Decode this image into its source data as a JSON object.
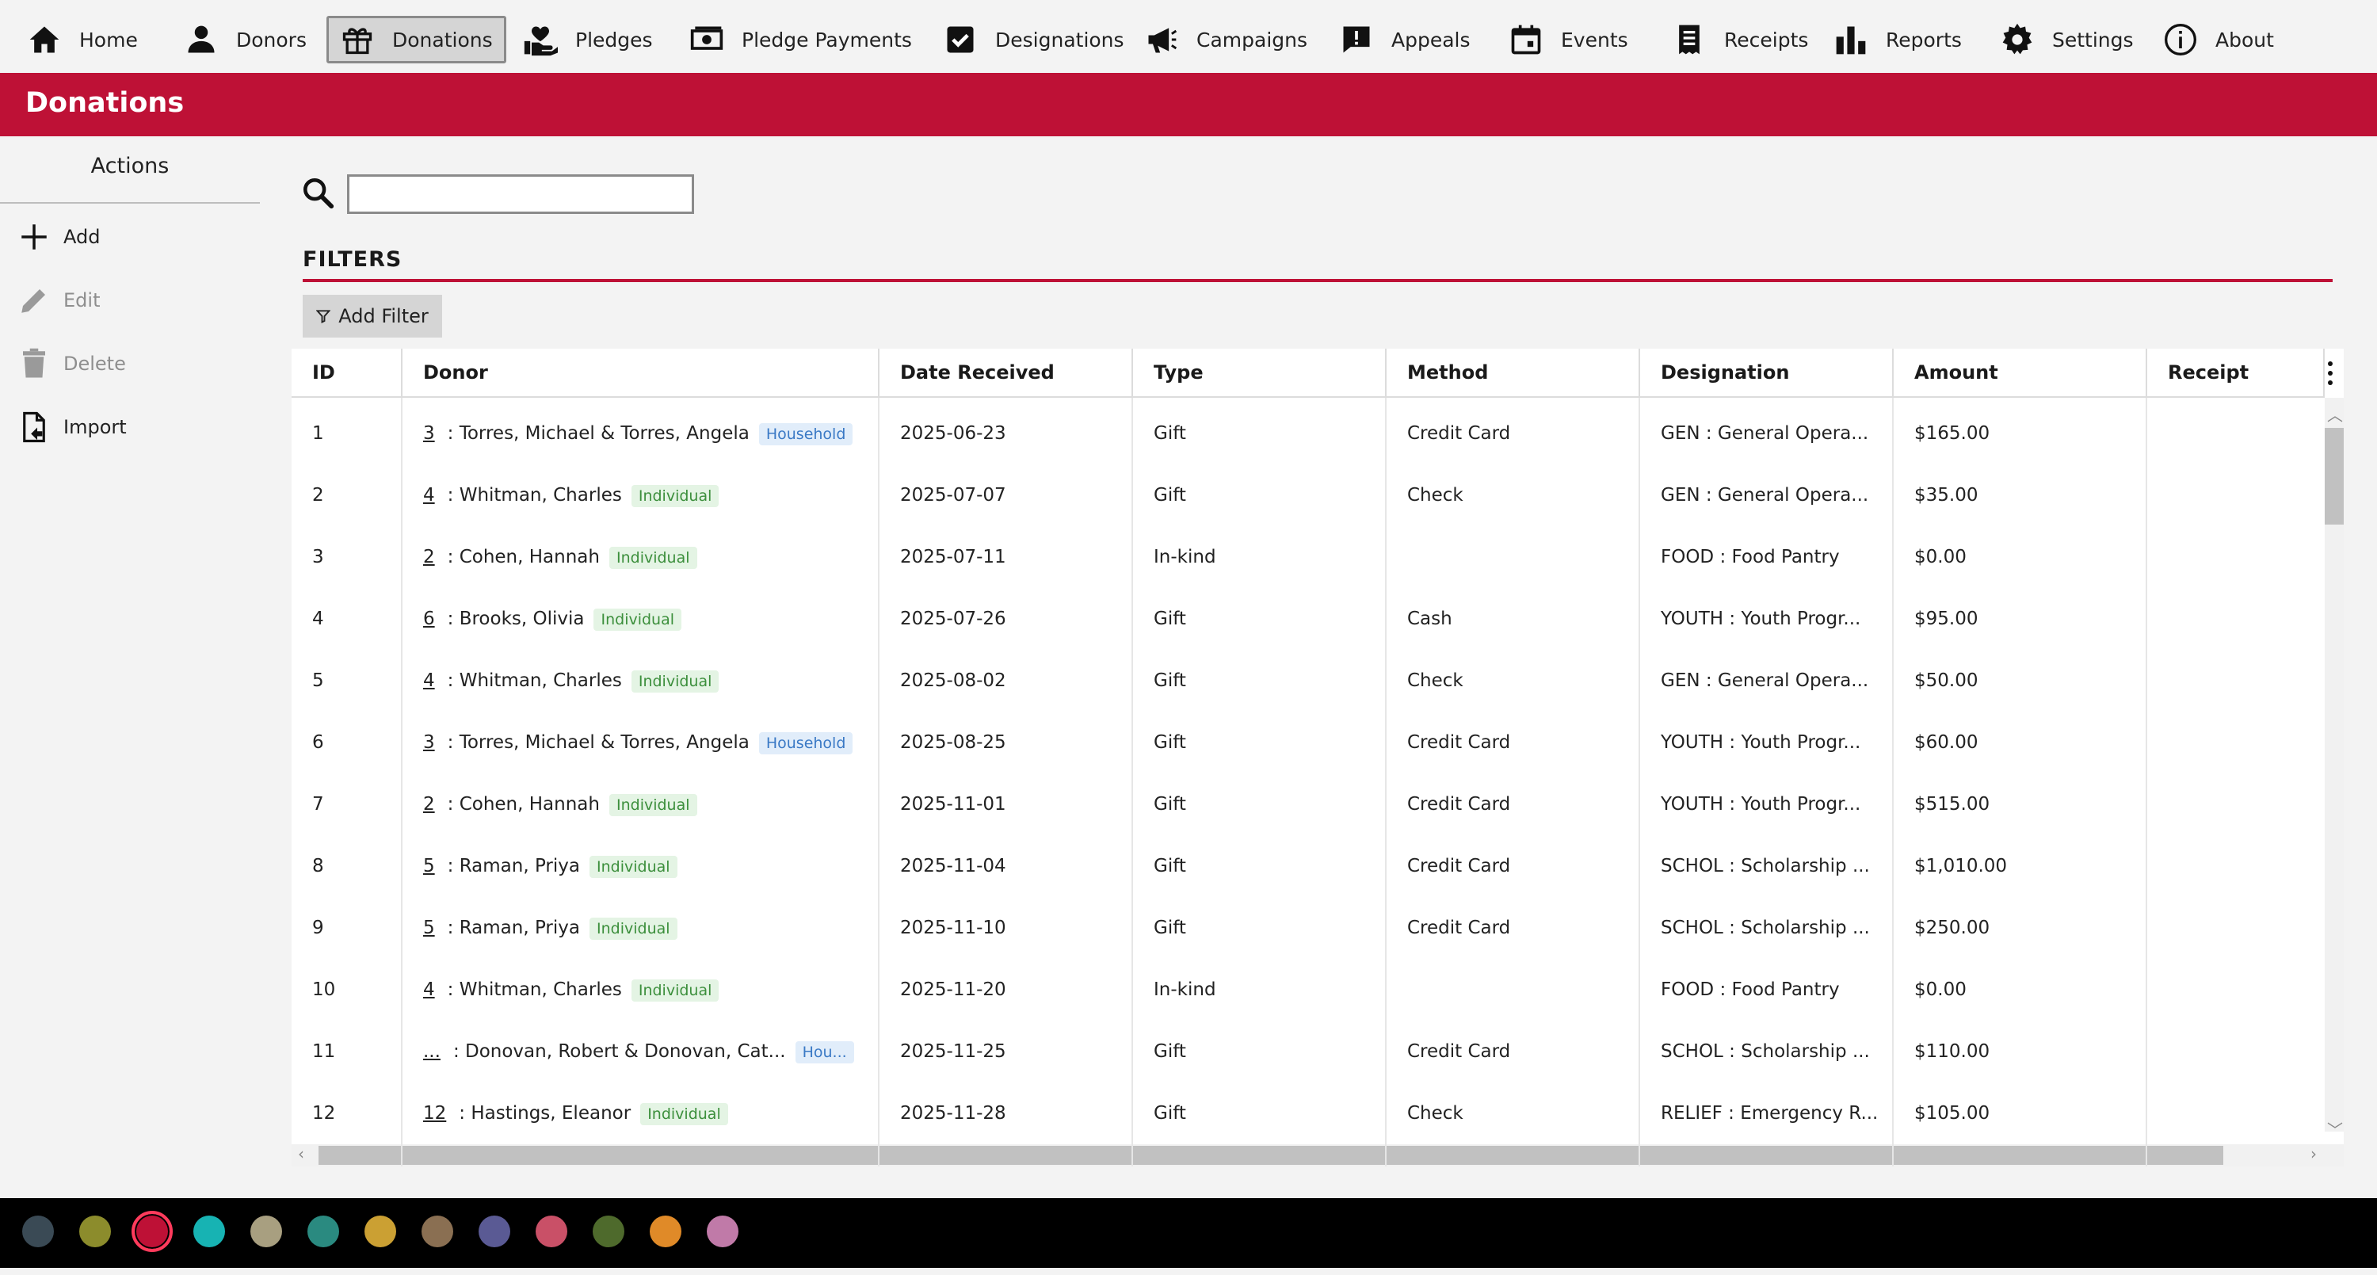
{
  "nav": {
    "items": [
      {
        "label": "Home",
        "icon": "home-icon"
      },
      {
        "label": "Donors",
        "icon": "person-icon"
      },
      {
        "label": "Donations",
        "icon": "gift-icon",
        "active": true
      },
      {
        "label": "Pledges",
        "icon": "hand-heart-icon"
      },
      {
        "label": "Pledge Payments",
        "icon": "cash-icon"
      },
      {
        "label": "Designations",
        "icon": "checkbox-icon"
      },
      {
        "label": "Campaigns",
        "icon": "megaphone-icon"
      },
      {
        "label": "Appeals",
        "icon": "alert-message-icon"
      },
      {
        "label": "Events",
        "icon": "calendar-icon"
      },
      {
        "label": "Receipts",
        "icon": "receipt-icon"
      },
      {
        "label": "Reports",
        "icon": "bar-chart-icon"
      },
      {
        "label": "Settings",
        "icon": "gear-icon"
      },
      {
        "label": "About",
        "icon": "info-icon"
      }
    ]
  },
  "page": {
    "title": "Donations"
  },
  "sidebar": {
    "heading": "Actions",
    "items": [
      {
        "label": "Add",
        "icon": "plus-icon",
        "enabled": true
      },
      {
        "label": "Edit",
        "icon": "pencil-icon",
        "enabled": false
      },
      {
        "label": "Delete",
        "icon": "trash-icon",
        "enabled": false
      },
      {
        "label": "Import",
        "icon": "file-import-icon",
        "enabled": true
      }
    ]
  },
  "search": {
    "value": "",
    "placeholder": ""
  },
  "filters": {
    "title": "FILTERS",
    "add_label": "Add Filter"
  },
  "table": {
    "columns": [
      "ID",
      "Donor",
      "Date Received",
      "Type",
      "Method",
      "Designation",
      "Amount",
      "Receipt"
    ],
    "rows": [
      {
        "id": "1",
        "donor_id": "3",
        "donor_name": ": Torres, Michael & Torres, Angela",
        "donor_type": "Household",
        "date": "2025-06-23",
        "type": "Gift",
        "method": "Credit Card",
        "designation": "GEN : General Opera...",
        "amount": "$165.00",
        "receipt": ""
      },
      {
        "id": "2",
        "donor_id": "4",
        "donor_name": ": Whitman, Charles",
        "donor_type": "Individual",
        "date": "2025-07-07",
        "type": "Gift",
        "method": "Check",
        "designation": "GEN : General Opera...",
        "amount": "$35.00",
        "receipt": ""
      },
      {
        "id": "3",
        "donor_id": "2",
        "donor_name": ": Cohen, Hannah",
        "donor_type": "Individual",
        "date": "2025-07-11",
        "type": "In-kind",
        "method": "",
        "designation": "FOOD : Food Pantry",
        "amount": "$0.00",
        "receipt": ""
      },
      {
        "id": "4",
        "donor_id": "6",
        "donor_name": ": Brooks, Olivia",
        "donor_type": "Individual",
        "date": "2025-07-26",
        "type": "Gift",
        "method": "Cash",
        "designation": "YOUTH : Youth Progr...",
        "amount": "$95.00",
        "receipt": ""
      },
      {
        "id": "5",
        "donor_id": "4",
        "donor_name": ": Whitman, Charles",
        "donor_type": "Individual",
        "date": "2025-08-02",
        "type": "Gift",
        "method": "Check",
        "designation": "GEN : General Opera...",
        "amount": "$50.00",
        "receipt": ""
      },
      {
        "id": "6",
        "donor_id": "3",
        "donor_name": ": Torres, Michael & Torres, Angela",
        "donor_type": "Household",
        "date": "2025-08-25",
        "type": "Gift",
        "method": "Credit Card",
        "designation": "YOUTH : Youth Progr...",
        "amount": "$60.00",
        "receipt": ""
      },
      {
        "id": "7",
        "donor_id": "2",
        "donor_name": ": Cohen, Hannah",
        "donor_type": "Individual",
        "date": "2025-11-01",
        "type": "Gift",
        "method": "Credit Card",
        "designation": "YOUTH : Youth Progr...",
        "amount": "$515.00",
        "receipt": ""
      },
      {
        "id": "8",
        "donor_id": "5",
        "donor_name": ": Raman, Priya",
        "donor_type": "Individual",
        "date": "2025-11-04",
        "type": "Gift",
        "method": "Credit Card",
        "designation": "SCHOL : Scholarship ...",
        "amount": "$1,010.00",
        "receipt": ""
      },
      {
        "id": "9",
        "donor_id": "5",
        "donor_name": ": Raman, Priya",
        "donor_type": "Individual",
        "date": "2025-11-10",
        "type": "Gift",
        "method": "Credit Card",
        "designation": "SCHOL : Scholarship ...",
        "amount": "$250.00",
        "receipt": ""
      },
      {
        "id": "10",
        "donor_id": "4",
        "donor_name": ": Whitman, Charles",
        "donor_type": "Individual",
        "date": "2025-11-20",
        "type": "In-kind",
        "method": "",
        "designation": "FOOD : Food Pantry",
        "amount": "$0.00",
        "receipt": ""
      },
      {
        "id": "11",
        "donor_id": "...",
        "donor_name": ": Donovan, Robert & Donovan, Cat...",
        "donor_type": "Hou...",
        "date": "2025-11-25",
        "type": "Gift",
        "method": "Credit Card",
        "designation": "SCHOL : Scholarship ...",
        "amount": "$110.00",
        "receipt": ""
      },
      {
        "id": "12",
        "donor_id": "12",
        "donor_name": ": Hastings, Eleanor",
        "donor_type": "Individual",
        "date": "2025-11-28",
        "type": "Gift",
        "method": "Check",
        "designation": "RELIEF : Emergency R...",
        "amount": "$105.00",
        "receipt": ""
      }
    ]
  },
  "theme": {
    "accent": "#be1136",
    "swatches": [
      "#3a4a55",
      "#8c8c2c",
      "#be1136",
      "#17b3b3",
      "#a89f80",
      "#2a8a80",
      "#cba033",
      "#8a6f52",
      "#5a5a94",
      "#c95067",
      "#4e6a2c",
      "#e08a28",
      "#c07aa8"
    ],
    "selected_swatch": 2
  }
}
